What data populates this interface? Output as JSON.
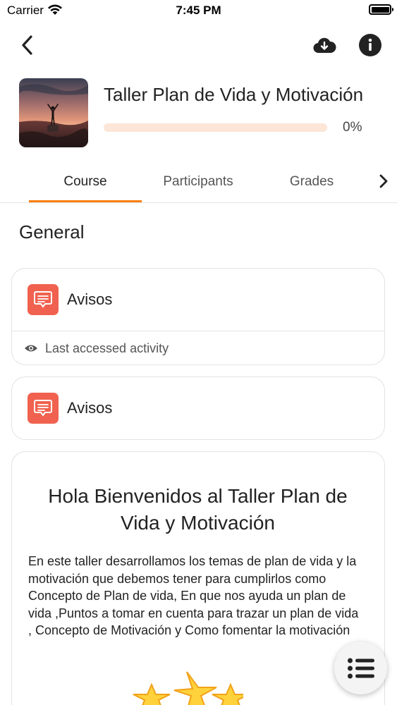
{
  "status_bar": {
    "carrier": "Carrier",
    "time": "7:45 PM"
  },
  "header": {
    "back_icon": "chevron-left-icon",
    "download_icon": "cloud-download-icon",
    "info_icon": "info-icon"
  },
  "course": {
    "title": "Taller Plan de Vida y Motivación",
    "progress_text": "0%",
    "progress_value": 0
  },
  "tabs": [
    {
      "label": "Course",
      "active": true
    },
    {
      "label": "Participants",
      "active": false
    },
    {
      "label": "Grades",
      "active": false
    }
  ],
  "section": {
    "title": "General"
  },
  "modules": [
    {
      "label": "Avisos",
      "icon": "forum-icon",
      "last_accessed_label": "Last accessed activity"
    },
    {
      "label": "Avisos",
      "icon": "forum-icon"
    }
  ],
  "welcome": {
    "heading": "Hola Bienvenidos al Taller Plan de Vida y Motivación",
    "body": "En este taller desarrollamos los temas de plan de vida y la motivación que debemos tener para cumplirlos como Concepto de Plan de vida, En que nos ayuda un plan de vida ,Puntos a tomar en cuenta para trazar un plan de vida , Concepto de Motivación y Como fomentar la motivación"
  },
  "colors": {
    "accent": "#f98012",
    "progress_track": "#fde6d7",
    "module_icon_bg": "#f0624f"
  }
}
